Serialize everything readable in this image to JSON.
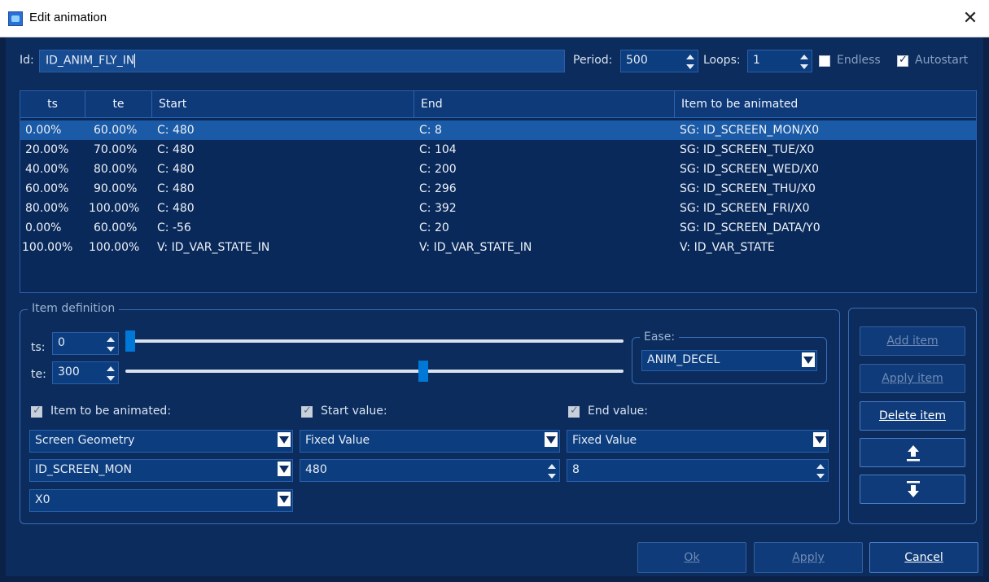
{
  "window": {
    "title": "Edit animation"
  },
  "top": {
    "id_label": "Id:",
    "id_value": "ID_ANIM_FLY_IN",
    "period_label": "Period:",
    "period_value": "500",
    "loops_label": "Loops:",
    "loops_value": "1",
    "endless_label": "Endless",
    "endless_checked": false,
    "autostart_label": "Autostart",
    "autostart_checked": true
  },
  "table": {
    "columns": [
      "ts",
      "te",
      "Start",
      "End",
      "Item to be animated"
    ],
    "rows": [
      [
        "0.00%",
        "60.00%",
        "C: 480",
        "C: 8",
        "SG: ID_SCREEN_MON/X0"
      ],
      [
        "20.00%",
        "70.00%",
        "C: 480",
        "C: 104",
        "SG: ID_SCREEN_TUE/X0"
      ],
      [
        "40.00%",
        "80.00%",
        "C: 480",
        "C: 200",
        "SG: ID_SCREEN_WED/X0"
      ],
      [
        "60.00%",
        "90.00%",
        "C: 480",
        "C: 296",
        "SG: ID_SCREEN_THU/X0"
      ],
      [
        "80.00%",
        "100.00%",
        "C: 480",
        "C: 392",
        "SG: ID_SCREEN_FRI/X0"
      ],
      [
        "0.00%",
        "60.00%",
        "C: -56",
        "C: 20",
        "SG: ID_SCREEN_DATA/Y0"
      ],
      [
        "100.00%",
        "100.00%",
        "V: ID_VAR_STATE_IN",
        "V: ID_VAR_STATE_IN",
        "V: ID_VAR_STATE"
      ]
    ],
    "selected_row": 0
  },
  "item_def": {
    "title": "Item definition",
    "ts_label": "ts:",
    "ts_value": "0",
    "ts_fraction": 0.0,
    "te_label": "te:",
    "te_value": "300",
    "te_fraction": 0.6,
    "ease_title": "Ease:",
    "ease_value": "ANIM_DECEL",
    "item_label": "Item to be animated:",
    "item_type": "Screen Geometry",
    "item_screen": "ID_SCREEN_MON",
    "item_coord": "X0",
    "start_label": "Start value:",
    "start_type": "Fixed Value",
    "start_value": "480",
    "end_label": "End value:",
    "end_type": "Fixed Value",
    "end_value": "8"
  },
  "side_buttons": {
    "add": "Add item",
    "apply": "Apply item",
    "delete": "Delete item"
  },
  "footer": {
    "ok": "Ok",
    "apply": "Apply",
    "cancel": "Cancel"
  }
}
